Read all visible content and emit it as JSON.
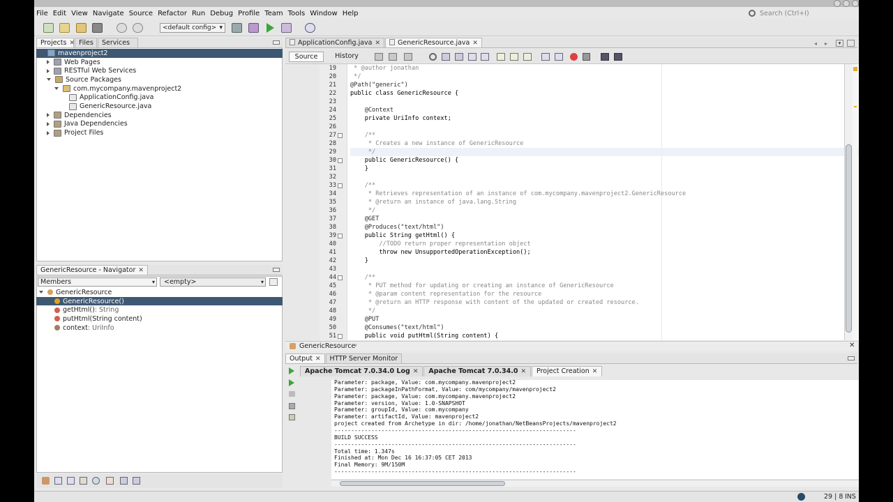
{
  "menu": [
    "File",
    "Edit",
    "View",
    "Navigate",
    "Source",
    "Refactor",
    "Run",
    "Debug",
    "Profile",
    "Team",
    "Tools",
    "Window",
    "Help"
  ],
  "search": {
    "placeholder": "Search (Ctrl+I)"
  },
  "toolbar": {
    "config": "<default config>"
  },
  "projects_tabs": [
    "Projects",
    "Files",
    "Services"
  ],
  "project_tree": [
    {
      "label": "mavenproject2",
      "level": 0,
      "exp": "d",
      "sel": true
    },
    {
      "label": "Web Pages",
      "level": 1,
      "exp": "r"
    },
    {
      "label": "RESTful Web Services",
      "level": 1,
      "exp": "r"
    },
    {
      "label": "Source Packages",
      "level": 1,
      "exp": "d"
    },
    {
      "label": "com.mycompany.mavenproject2",
      "level": 2,
      "exp": "d"
    },
    {
      "label": "ApplicationConfig.java",
      "level": 3,
      "exp": ""
    },
    {
      "label": "GenericResource.java",
      "level": 3,
      "exp": ""
    },
    {
      "label": "Dependencies",
      "level": 1,
      "exp": "r"
    },
    {
      "label": "Java Dependencies",
      "level": 1,
      "exp": "r"
    },
    {
      "label": "Project Files",
      "level": 1,
      "exp": "r"
    }
  ],
  "navigator": {
    "title": "GenericResource - Navigator",
    "filter": "Members",
    "empty": "<empty>",
    "items": [
      {
        "label": "GenericResource",
        "type": "",
        "level": 0
      },
      {
        "label": "GenericResource()",
        "type": "",
        "level": 1,
        "sel": true
      },
      {
        "label": "getHtml()",
        "type": " : String",
        "level": 1
      },
      {
        "label": "putHtml(String content)",
        "type": "",
        "level": 1
      },
      {
        "label": "context",
        "type": " : UriInfo",
        "level": 1
      }
    ]
  },
  "editor": {
    "tabs": [
      "ApplicationConfig.java",
      "GenericResource.java"
    ],
    "source_tab": "Source",
    "history_tab": "History",
    "breadcrumb": "GenericResource",
    "lines": [
      {
        "n": "19",
        "t": " * @author jonathan"
      },
      {
        "n": "20",
        "t": " */"
      },
      {
        "n": "21",
        "t": "@Path(\"generic\")"
      },
      {
        "n": "22",
        "t": "public class GenericResource {"
      },
      {
        "n": "23",
        "t": ""
      },
      {
        "n": "24",
        "t": "    @Context"
      },
      {
        "n": "25",
        "t": "    private UriInfo context;"
      },
      {
        "n": "26",
        "t": ""
      },
      {
        "n": "27",
        "t": "    /**"
      },
      {
        "n": "28",
        "t": "     * Creates a new instance of GenericResource"
      },
      {
        "n": "29",
        "t": "     */"
      },
      {
        "n": "30",
        "t": "    public GenericResource() {"
      },
      {
        "n": "31",
        "t": "    }"
      },
      {
        "n": "32",
        "t": ""
      },
      {
        "n": "33",
        "t": "    /**"
      },
      {
        "n": "34",
        "t": "     * Retrieves representation of an instance of com.mycompany.mavenproject2.GenericResource"
      },
      {
        "n": "35",
        "t": "     * @return an instance of java.lang.String"
      },
      {
        "n": "36",
        "t": "     */"
      },
      {
        "n": "37",
        "t": "    @GET"
      },
      {
        "n": "38",
        "t": "    @Produces(\"text/html\")"
      },
      {
        "n": "39",
        "t": "    public String getHtml() {"
      },
      {
        "n": "40",
        "t": "        //TODO return proper representation object"
      },
      {
        "n": "41",
        "t": "        throw new UnsupportedOperationException();"
      },
      {
        "n": "42",
        "t": "    }"
      },
      {
        "n": "43",
        "t": ""
      },
      {
        "n": "44",
        "t": "    /**"
      },
      {
        "n": "45",
        "t": "     * PUT method for updating or creating an instance of GenericResource"
      },
      {
        "n": "46",
        "t": "     * @param content representation for the resource"
      },
      {
        "n": "47",
        "t": "     * @return an HTTP response with content of the updated or created resource."
      },
      {
        "n": "48",
        "t": "     */"
      },
      {
        "n": "49",
        "t": "    @PUT"
      },
      {
        "n": "50",
        "t": "    @Consumes(\"text/html\")"
      },
      {
        "n": "51",
        "t": "    public void putHtml(String content) {"
      }
    ]
  },
  "output": {
    "top_tabs": [
      "Output",
      "HTTP Server Monitor"
    ],
    "sub_tabs": [
      "Apache Tomcat 7.0.34.0 Log",
      "Apache Tomcat 7.0.34.0",
      "Project Creation"
    ],
    "lines": [
      "Parameter: package, Value: com.mycompany.mavenproject2",
      "Parameter: packageInPathFormat, Value: com/mycompany/mavenproject2",
      "Parameter: package, Value: com.mycompany.mavenproject2",
      "Parameter: version, Value: 1.0-SNAPSHOT",
      "Parameter: groupId, Value: com.mycompany",
      "Parameter: artifactId, Value: mavenproject2",
      "project created from Archetype in dir: /home/jonathan/NetBeansProjects/mavenproject2",
      "------------------------------------------------------------------------",
      "BUILD SUCCESS",
      "------------------------------------------------------------------------",
      "Total time: 1.347s",
      "Finished at: Mon Dec 16 16:37:05 CET 2013",
      "Final Memory: 9M/150M",
      "------------------------------------------------------------------------"
    ]
  },
  "status": {
    "position": "29 | 8",
    "mode": "INS"
  }
}
